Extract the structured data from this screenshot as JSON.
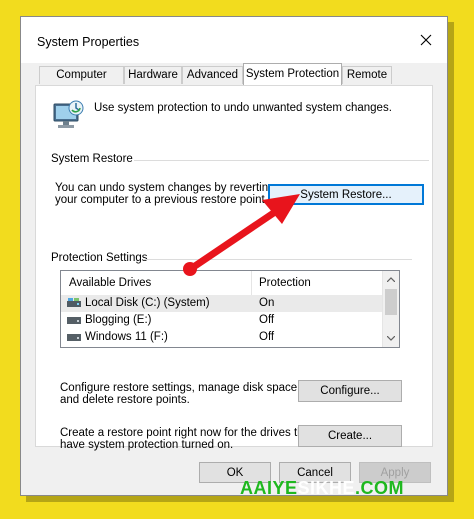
{
  "window": {
    "title": "System Properties"
  },
  "tabs": [
    {
      "label": "Computer Name"
    },
    {
      "label": "Hardware"
    },
    {
      "label": "Advanced"
    },
    {
      "label": "System Protection"
    },
    {
      "label": "Remote"
    }
  ],
  "intro": {
    "text": "Use system protection to undo unwanted system changes."
  },
  "restore": {
    "group_label": "System Restore",
    "description_line1": "You can undo system changes by reverting",
    "description_line2": "your computer to a previous restore point.",
    "button_label": "System Restore..."
  },
  "protection": {
    "group_label": "Protection Settings",
    "columns": [
      "Available Drives",
      "Protection"
    ],
    "drives": [
      {
        "name": "Local Disk (C:) (System)",
        "protection": "On"
      },
      {
        "name": "Blogging (E:)",
        "protection": "Off"
      },
      {
        "name": "Windows 11 (F:)",
        "protection": "Off"
      }
    ],
    "configure_line1": "Configure restore settings, manage disk space,",
    "configure_line2": "and delete restore points.",
    "configure_label": "Configure...",
    "create_line1": "Create a restore point right now for the drives that",
    "create_line2": "have system protection turned on.",
    "create_label": "Create..."
  },
  "footer": {
    "ok": "OK",
    "cancel": "Cancel",
    "apply": "Apply"
  },
  "watermark": {
    "part1": "AAIYE",
    "part2": "SIKHE",
    "part3": ".COM"
  },
  "colors": {
    "accent": "#0078d7",
    "arrow": "#e8141c",
    "watermark_green": "#1fb81f",
    "background": "#f2dc1e"
  }
}
